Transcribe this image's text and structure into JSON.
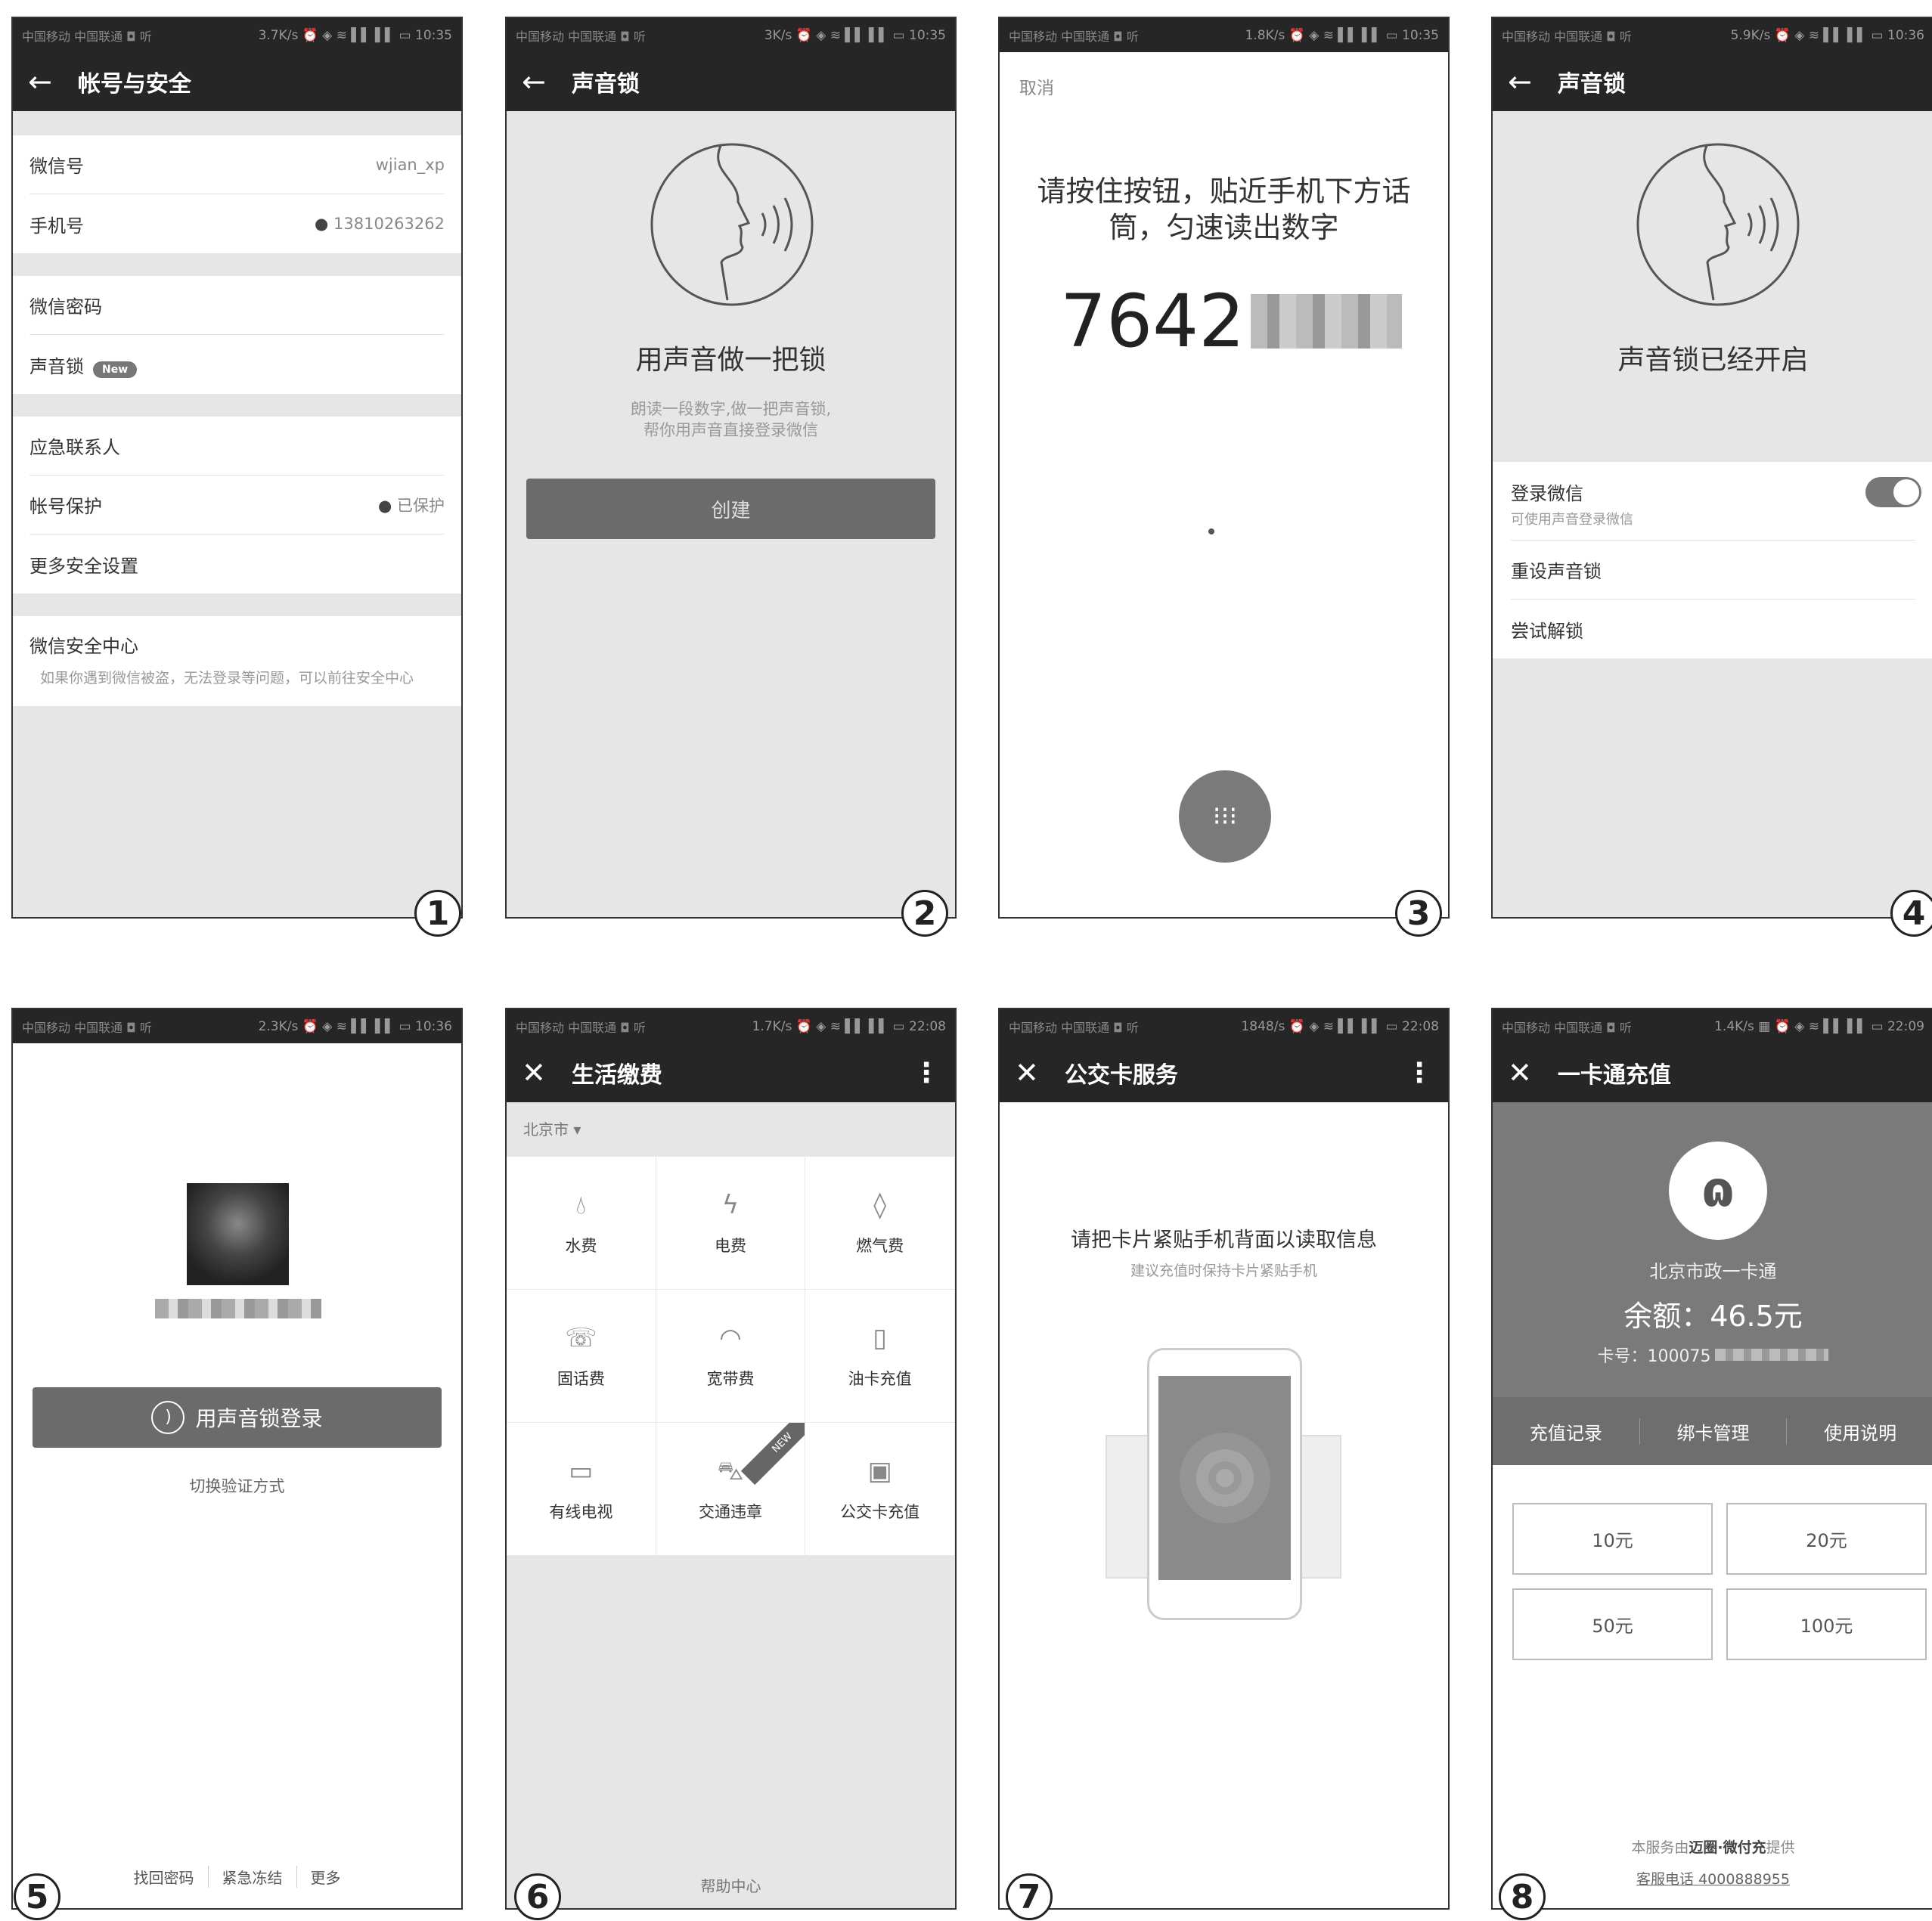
{
  "p1": {
    "status": {
      "left": "中国移动 中国联通 ◘ 听",
      "right": "3.7K/s ⏰ ◈ ≋ ▌▌ ▌▌ ▭ 10:35"
    },
    "title": "帐号与安全",
    "wechat_id_label": "微信号",
    "wechat_id_value": "wjian_xp",
    "phone_label": "手机号",
    "phone_value": "13810263262",
    "password_label": "微信密码",
    "voicelock_label": "声音锁",
    "new_badge": "New",
    "emergency_label": "应急联系人",
    "protect_label": "帐号保护",
    "protect_value": "已保护",
    "more_security_label": "更多安全设置",
    "center_title": "微信安全中心",
    "center_desc": "如果你遇到微信被盗，无法登录等问题，可以前往安全中心",
    "num": "1"
  },
  "p2": {
    "status": {
      "left": "中国移动 中国联通 ◘ 听",
      "right": "3K/s ⏰ ◈ ≋ ▌▌ ▌▌ ▭ 10:35"
    },
    "title": "声音锁",
    "headline": "用声音做一把锁",
    "desc1": "朗读一段数字,做一把声音锁,",
    "desc2": "帮你用声音直接登录微信",
    "create": "创建",
    "num": "2"
  },
  "p3": {
    "status": {
      "left": "中国移动 中国联通 ◘ 听",
      "right": "1.8K/s ⏰ ◈ ≋ ▌▌ ▌▌ ▭ 10:35"
    },
    "cancel": "取消",
    "instr1": "请按住按钮，贴近手机下方话",
    "instr2": "筒，匀速读出数字",
    "number": "7642",
    "num": "3"
  },
  "p4": {
    "status": {
      "left": "中国移动 中国联通 ◘ 听",
      "right": "5.9K/s ⏰ ◈ ≋ ▌▌ ▌▌ ▭ 10:36"
    },
    "title": "声音锁",
    "headline": "声音锁已经开启",
    "login_label": "登录微信",
    "login_sub": "可使用声音登录微信",
    "reset": "重设声音锁",
    "try": "尝试解锁",
    "num": "4"
  },
  "p5": {
    "status": {
      "left": "中国移动 中国联通 ◘ 听",
      "right": "2.3K/s ⏰ ◈ ≋ ▌▌ ▌▌ ▭ 10:36"
    },
    "login_btn": "用声音锁登录",
    "switch": "切换验证方式",
    "links": [
      "找回密码",
      "紧急冻结",
      "更多"
    ],
    "num": "5"
  },
  "p6": {
    "status": {
      "left": "中国移动 中国联通 ◘ 听",
      "right": "1.7K/s ⏰ ◈ ≋ ▌▌ ▌▌ ▭ 22:08"
    },
    "title": "生活缴费",
    "city": "北京市",
    "items": [
      "水费",
      "电费",
      "燃气费",
      "固话费",
      "宽带费",
      "油卡充值",
      "有线电视",
      "交通违章",
      "公交卡充值"
    ],
    "new_tag": "NEW",
    "help": "帮助中心",
    "num": "6"
  },
  "p7": {
    "status": {
      "left": "中国移动 中国联通 ◘ 听",
      "right": "1848/s ⏰ ◈ ≋ ▌▌ ▌▌ ▭ 22:08"
    },
    "title": "公交卡服务",
    "headline": "请把卡片紧贴手机背面以读取信息",
    "sub": "建议充值时保持卡片紧贴手机",
    "num": "7"
  },
  "p8": {
    "status": {
      "left": "中国移动 中国联通 ◘ 听",
      "right": "1.4K/s ▦ ⏰ ◈ ≋ ▌▌ ▌▌ ▭ 22:09"
    },
    "title": "一卡通充值",
    "card_name": "北京市政一卡通",
    "balance": "余额：46.5元",
    "card_no": "卡号：100075",
    "tabs": [
      "充值记录",
      "绑卡管理",
      "使用说明"
    ],
    "amounts": [
      "10元",
      "20元",
      "50元",
      "100元"
    ],
    "footer1_a": "本服务由",
    "footer1_b": "迈圈·微付充",
    "footer1_c": "提供",
    "footer2": "客服电话 4000888955",
    "num": "8"
  }
}
